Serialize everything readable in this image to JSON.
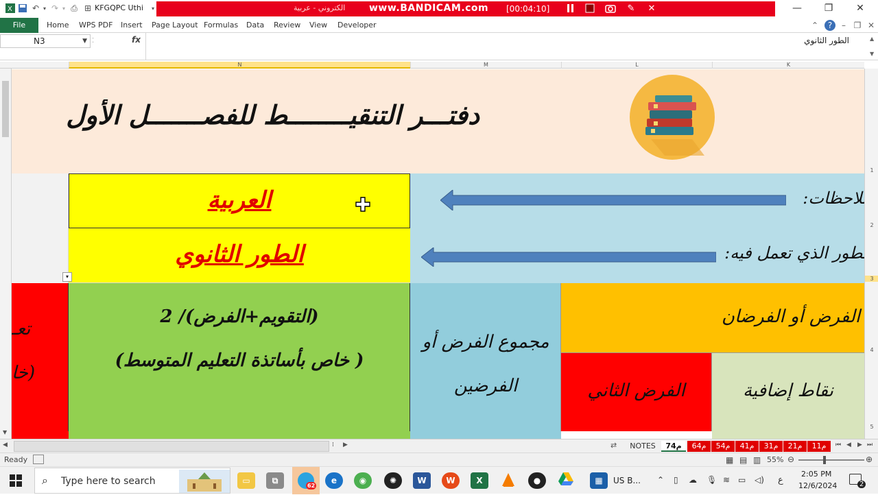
{
  "titlebar": {
    "font_name": "KFGQPC Uthi",
    "recording_title": "الكتروني - عربية",
    "recorder_brand": "www.BANDICAM.com",
    "recording_time": "[00:04:10]"
  },
  "ribbon": {
    "file_label": "File",
    "tabs": [
      "Home",
      "WPS PDF",
      "Insert",
      "Page Layout",
      "Formulas",
      "Data",
      "Review",
      "View",
      "Developer"
    ]
  },
  "formula_bar": {
    "name_box": "N3",
    "fx_label": "fx",
    "content": "الطور الثانوي"
  },
  "columns": [
    "N",
    "M",
    "L",
    "K"
  ],
  "rows": [
    "1",
    "2",
    "3",
    "4",
    "5"
  ],
  "sheet": {
    "title": "دفتـــر التنقيــــــــط للفصـــــــل الأول",
    "notes_label": "ملاحظات:",
    "level_label": "الطور الذي تعمل فيه:",
    "subject": "العربية",
    "level": "الطور الثانوي",
    "red_header_top": "تعـ",
    "red_header_bottom": "(خا",
    "green_header_line1": "(التقويم+الفرض)/ 2",
    "green_header_line2": "( خاص بأساتذة التعليم المتوسط)",
    "blue_header": "مجموع الفرض أو الفرضين",
    "orange_header": "الفرض أو الفرضان",
    "second_test": "الفرض الثاني",
    "extra_points": "نقاط إضافية"
  },
  "sheet_tabs": {
    "notes": "NOTES",
    "active": "7م4",
    "others": [
      "6م4",
      "5م4",
      "4م1",
      "3م1",
      "2م1",
      "1م1"
    ]
  },
  "status": {
    "ready": "Ready",
    "zoom": "55%"
  },
  "taskbar": {
    "search_placeholder": "Type here to search",
    "telegram_badge": "62",
    "lang_item": "US B...",
    "ime": "ع",
    "time": "2:05 PM",
    "date": "12/6/2024",
    "notif_count": "2"
  },
  "colors": {
    "excel_green": "#217346",
    "header_bg": "#fdeada",
    "yellow": "#ffff00",
    "light_blue": "#b7dde8",
    "red": "#ff0000",
    "green": "#92d050",
    "sky": "#92cddc",
    "orange": "#ffc000",
    "pale_green": "#d8e4bc",
    "arrow_blue": "#4f81bd"
  }
}
